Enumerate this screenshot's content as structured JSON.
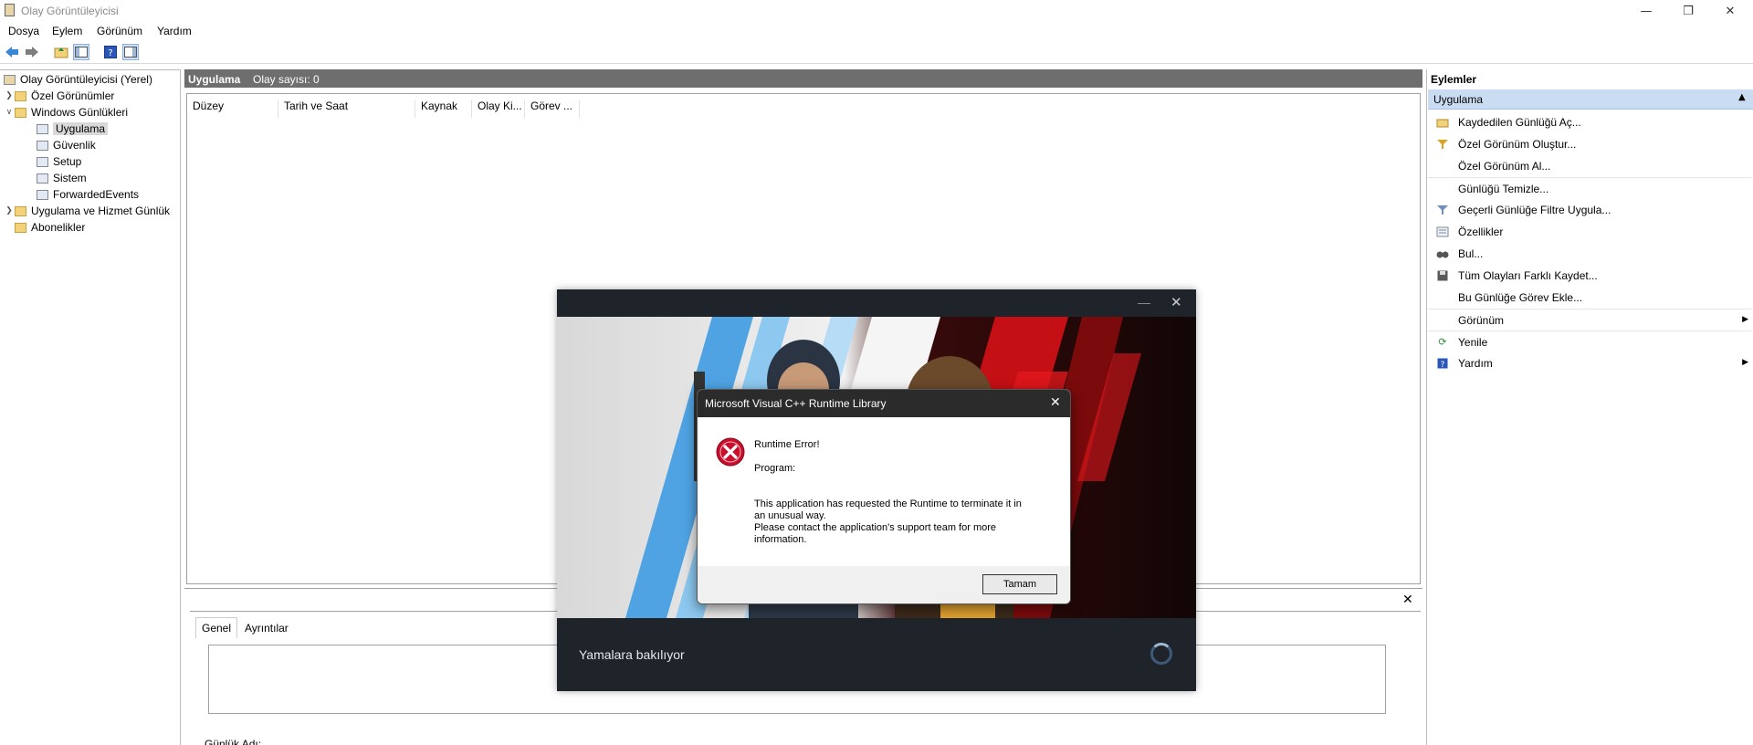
{
  "window": {
    "title": "Olay Görüntüleyicisi"
  },
  "menu": [
    "Dosya",
    "Eylem",
    "Görünüm",
    "Yardım"
  ],
  "tree": {
    "root": "Olay Görüntüleyicisi (Yerel)",
    "custom_views": "Özel Görünümler",
    "windows_logs": "Windows Günlükleri",
    "logs": [
      "Uygulama",
      "Güvenlik",
      "Setup",
      "Sistem",
      "ForwardedEvents"
    ],
    "app_service_logs": "Uygulama ve Hizmet Günlük",
    "subscriptions": "Abonelikler"
  },
  "center": {
    "title": "Uygulama",
    "event_count": "Olay sayısı: 0",
    "columns": [
      "Düzey",
      "Tarih ve Saat",
      "Kaynak",
      "Olay Ki...",
      "Görev ..."
    ],
    "tabs": [
      "Genel",
      "Ayrıntılar"
    ],
    "log_name_label": "Günlük Adı:"
  },
  "actions": {
    "header": "Eylemler",
    "section": "Uygulama",
    "items": [
      "Kaydedilen Günlüğü Aç...",
      "Özel Görünüm Oluştur...",
      "Özel Görünüm Al...",
      "Günlüğü Temizle...",
      "Geçerli Günlüğe Filtre Uygula...",
      "Özellikler",
      "Bul...",
      "Tüm Olayları Farklı Kaydet...",
      "Bu Günlüğe Görev Ekle...",
      "Görünüm",
      "Yenile",
      "Yardım"
    ]
  },
  "game": {
    "status": "Yamalara bakılıyor"
  },
  "dialog": {
    "title": "Microsoft Visual C++ Runtime Library",
    "heading": "Runtime Error!",
    "program_label": "Program:",
    "message1": "This application has requested the Runtime to terminate it in an unusual way.",
    "message2": "Please contact the application's support team for more information.",
    "ok_label": "Tamam"
  },
  "colors": {
    "header_gray": "#6e6e6e",
    "action_section": "#c9dcf2",
    "dialog_title": "#2b2b2b",
    "error_red": "#c8102e"
  }
}
